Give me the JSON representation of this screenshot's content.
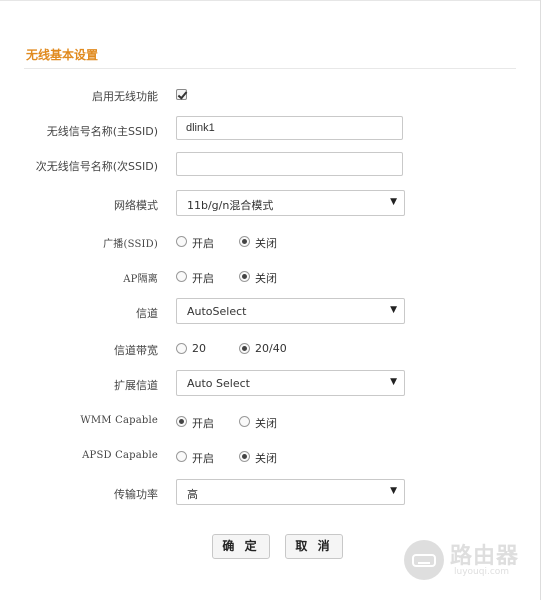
{
  "section_title": "无线基本设置",
  "fields": {
    "enable_wireless": {
      "label": "启用无线功能",
      "checked": true
    },
    "main_ssid": {
      "label": "无线信号名称(主SSID)",
      "value": "dlink1"
    },
    "sub_ssid": {
      "label": "次无线信号名称(次SSID)",
      "value": ""
    },
    "network_mode": {
      "label": "网络模式",
      "value": "11b/g/n混合模式"
    },
    "broadcast": {
      "label": "广播(SSID)",
      "options": [
        "开启",
        "关闭"
      ],
      "selected": "关闭"
    },
    "ap_isolation": {
      "label": "AP隔离",
      "options": [
        "开启",
        "关闭"
      ],
      "selected": "关闭"
    },
    "channel": {
      "label": "信道",
      "value": "AutoSelect"
    },
    "channel_bandwidth": {
      "label": "信道带宽",
      "options": [
        "20",
        "20/40"
      ],
      "selected": "20/40"
    },
    "ext_channel": {
      "label": "扩展信道",
      "value": "Auto Select"
    },
    "wmm": {
      "label": "WMM Capable",
      "options": [
        "开启",
        "关闭"
      ],
      "selected": "开启"
    },
    "apsd": {
      "label": "APSD Capable",
      "options": [
        "开启",
        "关闭"
      ],
      "selected": "关闭"
    },
    "tx_power": {
      "label": "传输功率",
      "value": "高"
    }
  },
  "buttons": {
    "confirm": "确 定",
    "cancel": "取 消"
  },
  "watermark": {
    "text": "路由器",
    "sub": "luyouqi.com"
  },
  "colors": {
    "accent": "#e08a1e"
  }
}
